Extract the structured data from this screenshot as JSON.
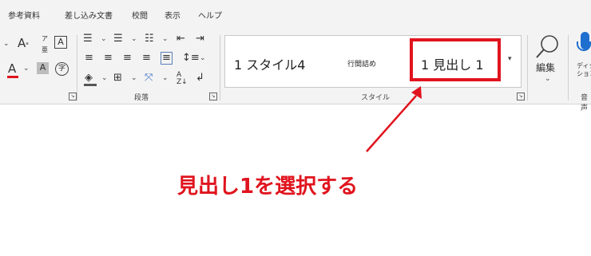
{
  "tabs": [
    "参考資料",
    "差し込み文書",
    "校閲",
    "表示",
    "ヘルプ"
  ],
  "groups": {
    "paragraph_label": "段落",
    "styles_label": "スタイル",
    "voice_label": "音声"
  },
  "styles": {
    "item1": "1 スタイル4",
    "item2": "行間詰め",
    "item3": "1 見出し 1"
  },
  "editing": {
    "label": "編集"
  },
  "dictate": {
    "label1": "ディクテー",
    "label2": "ション"
  },
  "font_tools": {
    "ruby_top": "ア",
    "ruby_bottom": "亜",
    "boxed": "A",
    "enclosed": "字",
    "shade": "A"
  },
  "annotation": "見出し1を選択する",
  "colors": {
    "accent": "#e0141e",
    "font_color": "#e0141e"
  }
}
